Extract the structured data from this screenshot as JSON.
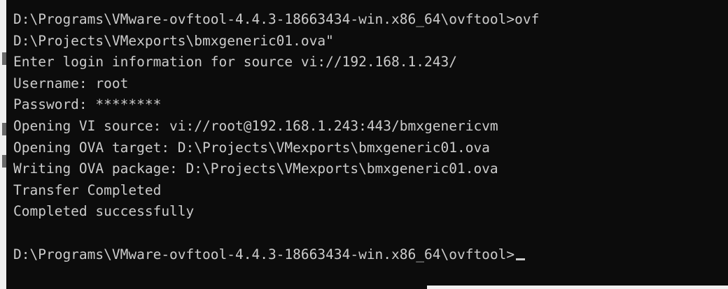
{
  "colors": {
    "background": "#0c0c0c",
    "text": "#cccccc",
    "window_edge": "#f0f0f0"
  },
  "console": {
    "lines": [
      "D:\\Programs\\VMware-ovftool-4.4.3-18663434-win.x86_64\\ovftool>ovf",
      "D:\\Projects\\VMexports\\bmxgeneric01.ova\"",
      "Enter login information for source vi://192.168.1.243/",
      "Username: root",
      "Password: ********",
      "Opening VI source: vi://root@192.168.1.243:443/bmxgenericvm",
      "Opening OVA target: D:\\Projects\\VMexports\\bmxgeneric01.ova",
      "Writing OVA package: D:\\Projects\\VMexports\\bmxgeneric01.ova",
      "Transfer Completed",
      "Completed successfully",
      ""
    ],
    "prompt": "D:\\Programs\\VMware-ovftool-4.4.3-18663434-win.x86_64\\ovftool>"
  }
}
